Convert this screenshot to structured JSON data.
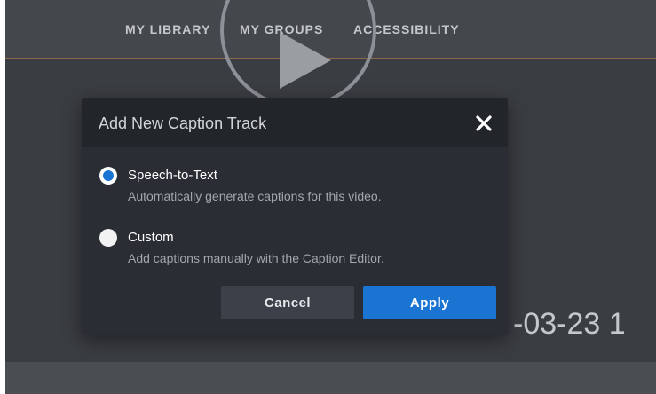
{
  "nav": {
    "items": [
      {
        "label": "MY LIBRARY"
      },
      {
        "label": "MY GROUPS"
      },
      {
        "label": "ACCESSIBILITY"
      }
    ]
  },
  "background": {
    "date_fragment": "-03-23  1",
    "play_icon": "play-icon"
  },
  "dialog": {
    "title": "Add New Caption Track",
    "close_icon": "close-icon",
    "options": [
      {
        "label": "Speech-to-Text",
        "description": "Automatically generate captions for this video.",
        "selected": true
      },
      {
        "label": "Custom",
        "description": "Add captions manually with the Caption Editor.",
        "selected": false
      }
    ],
    "cancel_label": "Cancel",
    "apply_label": "Apply"
  },
  "colors": {
    "accent": "#1a74d2",
    "dialog_bg": "#2a2d33",
    "header_bg": "#22252a",
    "page_bg": "#3a3d42"
  }
}
